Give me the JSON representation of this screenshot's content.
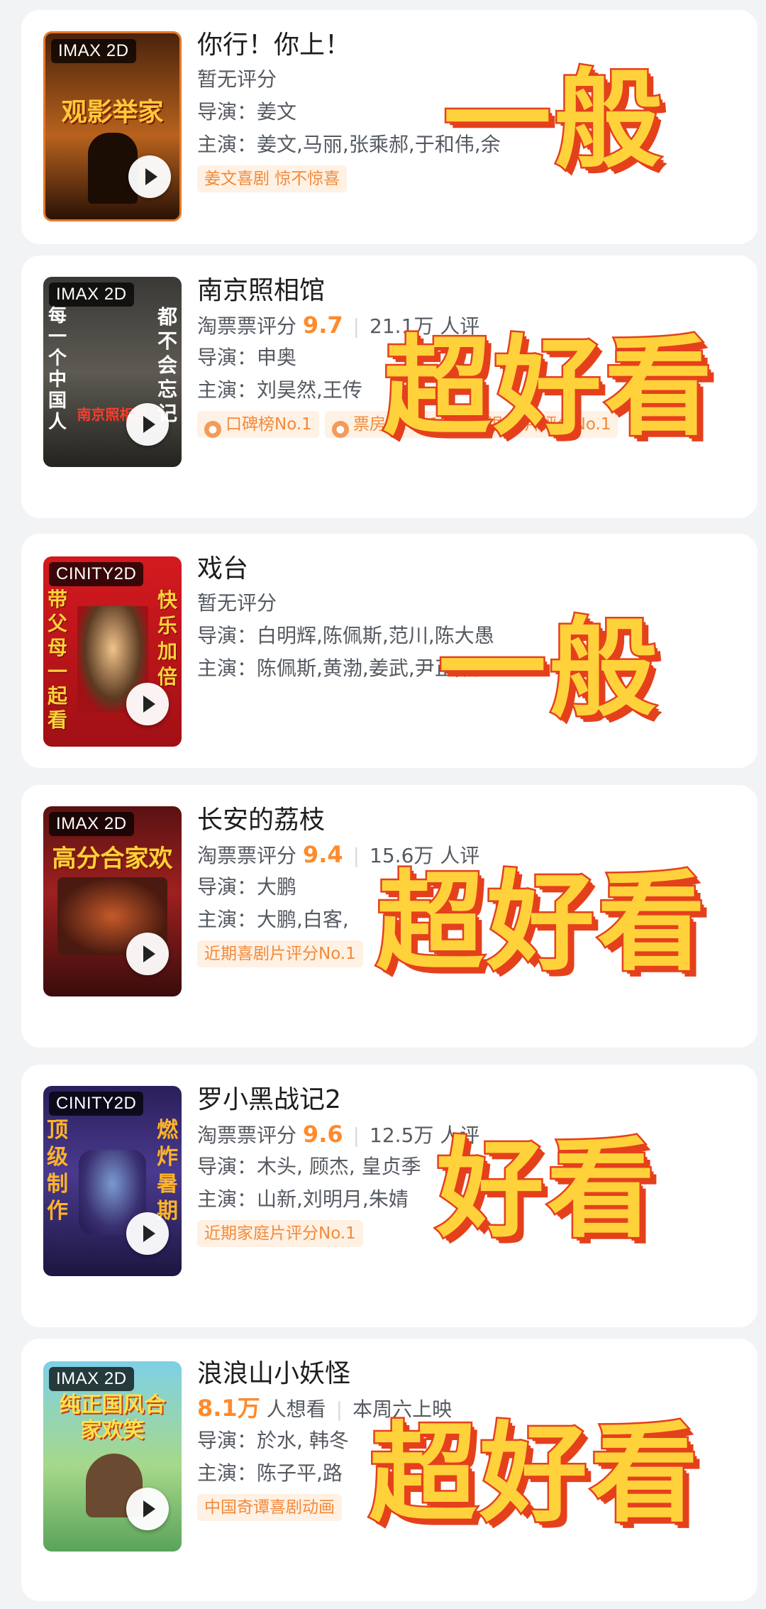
{
  "movies": [
    {
      "title": "你行！你上！",
      "score_prefix": "暂无评分",
      "score": "",
      "count": "",
      "director_label": "导演：",
      "director": "姜文",
      "cast_label": "主演：",
      "cast": "姜文,马丽,张乘郝,于和伟,余",
      "tags": [
        "姜文喜剧 惊不惊喜"
      ],
      "poster_badge": "IMAX 2D",
      "poster_text": "观影举家",
      "overlay": "一般",
      "poster_bg": "#3b1d0c"
    },
    {
      "title": "南京照相馆",
      "score_prefix": "淘票票评分",
      "score": "9.7",
      "count": "21.1万 人评",
      "director_label": "导演：",
      "director": "申奥",
      "cast_label": "主演：",
      "cast": "刘昊然,王传",
      "tags": [
        "口碑榜No.1",
        "票房榜No.1",
        "近期剧情片评分No.1"
      ],
      "poster_badge": "IMAX 2D",
      "poster_text": "南京照相馆",
      "poster_vert_left": "每一个中国人",
      "poster_vert_right": "都不会忘记",
      "overlay": "超好看",
      "poster_bg": "#2c2b29"
    },
    {
      "title": "戏台",
      "score_prefix": "暂无评分",
      "score": "",
      "count": "",
      "director_label": "导演：",
      "director": "白明辉,陈佩斯,范川,陈大愚",
      "cast_label": "主演：",
      "cast": "陈佩斯,黄渤,姜武,尹正,杨",
      "tags": [],
      "poster_badge": "CINITY2D",
      "poster_vert_left": "带父母一起看",
      "poster_vert_right": "快乐加倍",
      "overlay": "一般",
      "poster_bg": "#c7161b"
    },
    {
      "title": "长安的荔枝",
      "score_prefix": "淘票票评分",
      "score": "9.4",
      "count": "15.6万 人评",
      "director_label": "导演：",
      "director": "大鹏",
      "cast_label": "主演：",
      "cast": "大鹏,白客,",
      "tags": [
        "近期喜剧片评分No.1"
      ],
      "poster_badge": "IMAX 2D",
      "poster_text": "高分合家欢",
      "overlay": "超好看",
      "poster_bg": "#8e1717"
    },
    {
      "title": "罗小黑战记2",
      "score_prefix": "淘票票评分",
      "score": "9.6",
      "count": "12.5万 人评",
      "director_label": "导演：",
      "director": "木头, 顾杰, 皇贞季",
      "cast_label": "主演：",
      "cast": "山新,刘明月,朱婧",
      "tags": [
        "近期家庭片评分No.1"
      ],
      "poster_badge": "CINITY2D",
      "poster_vert_left": "顶级制作",
      "poster_vert_right": "燃炸暑期",
      "overlay": "好看",
      "poster_bg": "#2b2357"
    },
    {
      "title": "浪浪山小妖怪",
      "score_prefix": "",
      "score": "8.1万",
      "count": "人想看",
      "extra": "本周六上映",
      "director_label": "导演：",
      "director": "於水, 韩冬",
      "cast_label": "主演：",
      "cast": "陈子平,路",
      "tags": [
        "中国奇谭喜剧动画"
      ],
      "poster_badge": "IMAX 2D",
      "poster_text": "纯正国风合家欢笑",
      "overlay": "超好看",
      "poster_bg": "#6cbfd8"
    }
  ],
  "colors": {
    "accent": "#ff8a2a",
    "tag_bg": "#fff1e3",
    "overlay_fill": "#ffd23b",
    "overlay_stroke": "#e5401c"
  }
}
